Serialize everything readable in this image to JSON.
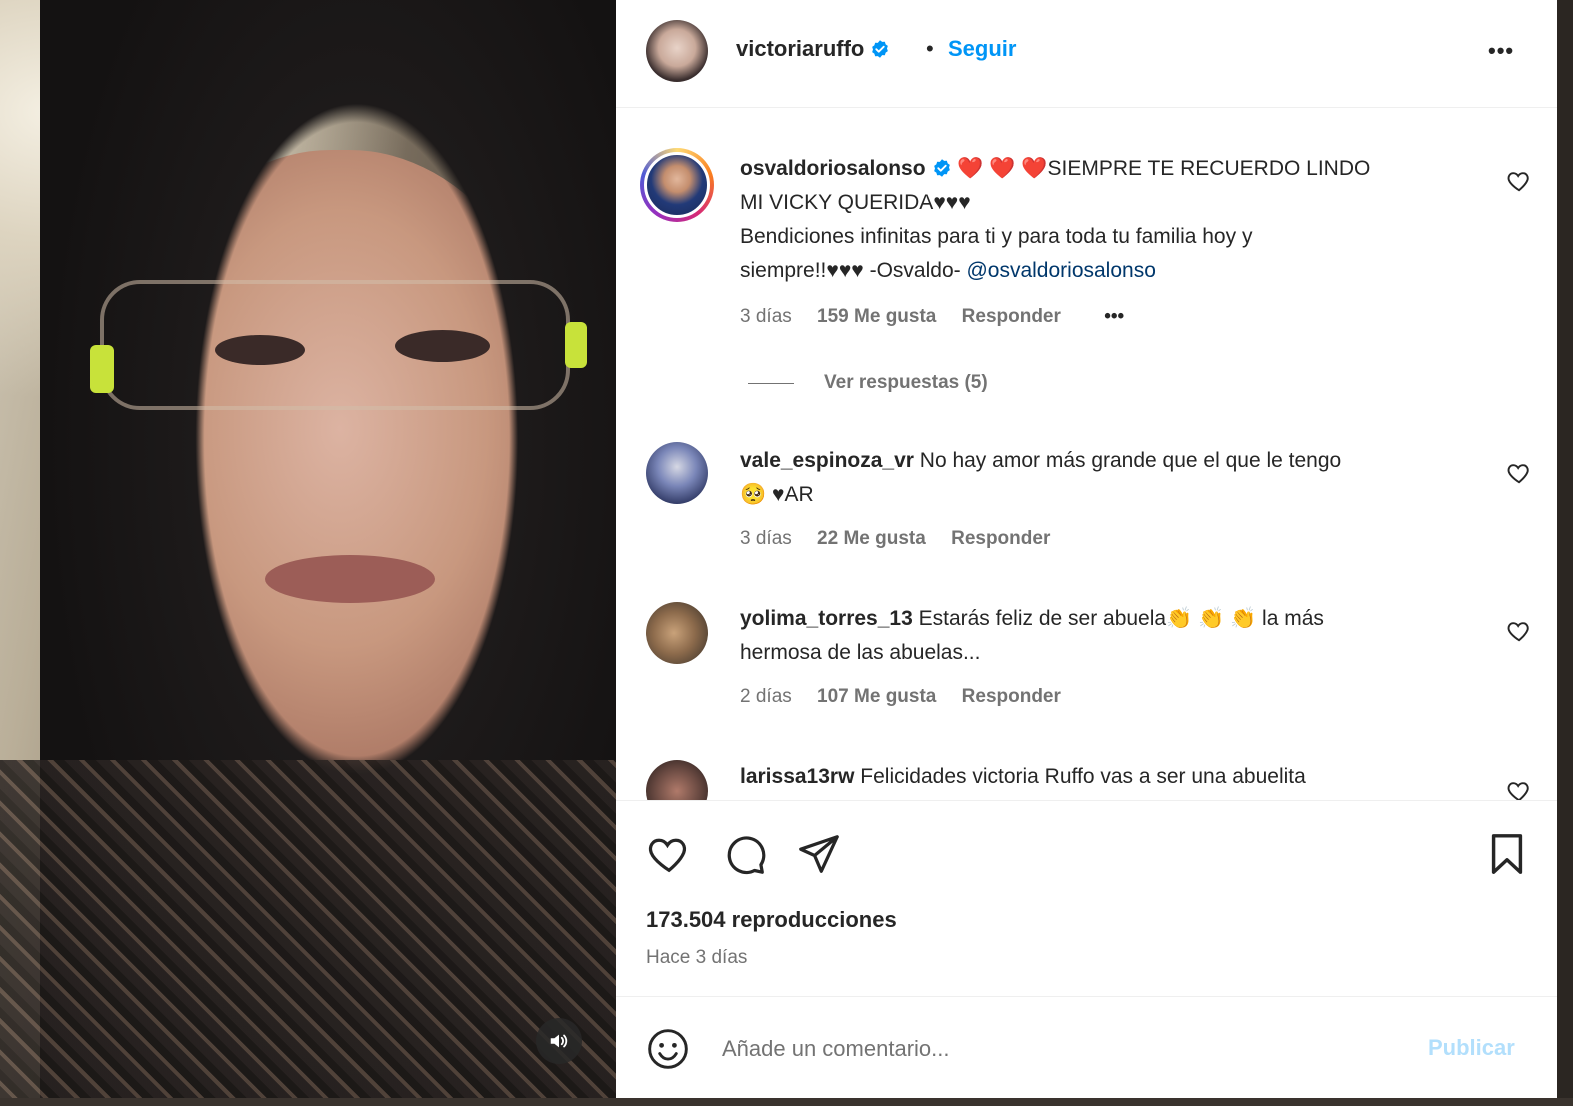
{
  "post": {
    "author": "victoriaruffo",
    "separator": "•",
    "follow_label": "Seguir",
    "more_label": "•••"
  },
  "comments": [
    {
      "username": "osvaldoriosalonso",
      "text_line1": " ❤️ ❤️ ❤️SIEMPRE TE RECUERDO LINDO",
      "text_line2": "MI VICKY QUERIDA♥♥♥",
      "text_line3": "Bendiciones infinitas para ti y para toda tu familia hoy y",
      "text_line4": "siempre!!♥♥♥ -Osvaldo- ",
      "mention": "@osvaldoriosalonso",
      "time": "3 días",
      "likes": "159 Me gusta",
      "reply": "Responder",
      "options": "•••",
      "view_replies": "Ver respuestas (5)"
    },
    {
      "username": "vale_espinoza_vr",
      "text_line1": " No hay amor más grande que el que le tengo",
      "text_line2": "🥺 ♥AR",
      "time": "3 días",
      "likes": "22 Me gusta",
      "reply": "Responder"
    },
    {
      "username": "yolima_torres_13",
      "text_line1": " Estarás feliz de ser abuela👏 👏 👏 la más",
      "text_line2": "hermosa de las abuelas...",
      "time": "2 días",
      "likes": "107 Me gusta",
      "reply": "Responder"
    },
    {
      "username": "larissa13rw",
      "text_line1": " Felicidades victoria Ruffo vas a ser una abuelita"
    }
  ],
  "stats": {
    "views": "173.504 reproducciones",
    "posted": "Hace 3 días"
  },
  "composer": {
    "placeholder": "Añade un comentario...",
    "publish_label": "Publicar"
  },
  "colors": {
    "accent": "#0095f6",
    "publish_disabled": "#b2dffc",
    "secondary_text": "#737373"
  }
}
